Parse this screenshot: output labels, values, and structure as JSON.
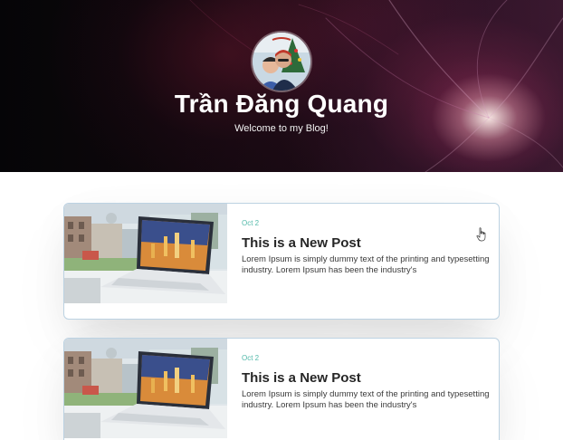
{
  "profile": {
    "name": "Trần Đăng Quang",
    "subtitle": "Welcome to my Blog!"
  },
  "icons": {
    "avatar": "profile-photo",
    "cursor": "hand-pointer-icon"
  },
  "colors": {
    "hero_background": "#0a0608",
    "card_border": "#bcd2e2",
    "date_accent": "#52b9a9",
    "title_text": "#262626",
    "body_text": "#3a3a3a"
  },
  "posts": [
    {
      "date": "Oct 2",
      "title": "This is a New Post",
      "excerpt": "Lorem Ipsum is simply dummy text of the printing and typesetting industry. Lorem Ipsum has been the industry's"
    },
    {
      "date": "Oct 2",
      "title": "This is a New Post",
      "excerpt": "Lorem Ipsum is simply dummy text of the printing and typesetting industry. Lorem Ipsum has been the industry's"
    }
  ]
}
